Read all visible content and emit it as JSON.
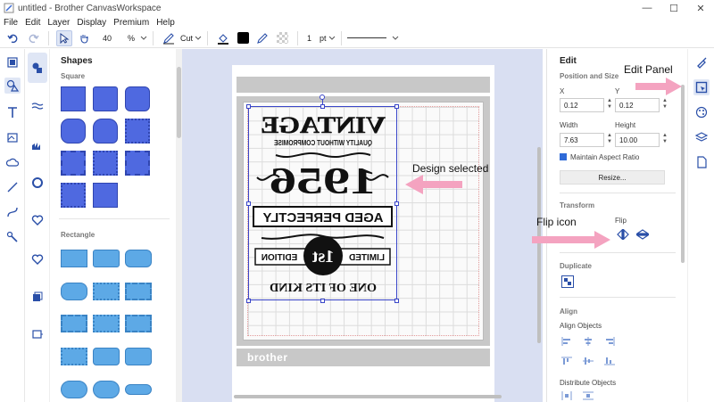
{
  "window": {
    "title": "untitled - Brother CanvasWorkspace",
    "minimize": "—",
    "maximize": "☐",
    "close": "✕"
  },
  "menu": [
    "File",
    "Edit",
    "Layer",
    "Display",
    "Premium",
    "Help"
  ],
  "toolbar": {
    "zoom_value": "40",
    "zoom_unit": "%",
    "cut_label": "Cut",
    "line_width": "1",
    "line_unit": "pt"
  },
  "shapes_panel": {
    "title": "Shapes",
    "section_square": "Square",
    "section_rectangle": "Rectangle"
  },
  "design": {
    "line1": "VINTAGE",
    "line2": "QUALITY WITHOUT COMPROMISE",
    "line3": "1956",
    "line4": "AGED PERFECTLY",
    "line5": "LIMITED",
    "line6": "1st",
    "line7": "EDITION",
    "line8": "ONE OF ITS KIND"
  },
  "mat": {
    "brand": "brother"
  },
  "edit_panel": {
    "title": "Edit",
    "position_size": "Position and Size",
    "x_label": "X",
    "x_value": "0.12",
    "y_label": "Y",
    "y_value": "0.12",
    "width_label": "Width",
    "width_value": "7.63",
    "height_label": "Height",
    "height_value": "10.00",
    "maintain_aspect": "Maintain Aspect Ratio",
    "resize_button": "Resize...",
    "transform": "Transform",
    "flip_label": "Flip",
    "duplicate": "Duplicate",
    "align": "Align",
    "align_objects": "Align Objects",
    "distribute_objects": "Distribute Objects"
  },
  "annotations": {
    "edit_panel": "Edit Panel",
    "design_selected": "Design selected",
    "flip_icon": "Flip icon"
  },
  "colors": {
    "accent": "#3a46c9",
    "shape_fill": "#4f69e0",
    "rect_fill": "#5da9e6",
    "canvas_bg": "#d9dff2",
    "arrow": "#f4a3c0"
  }
}
